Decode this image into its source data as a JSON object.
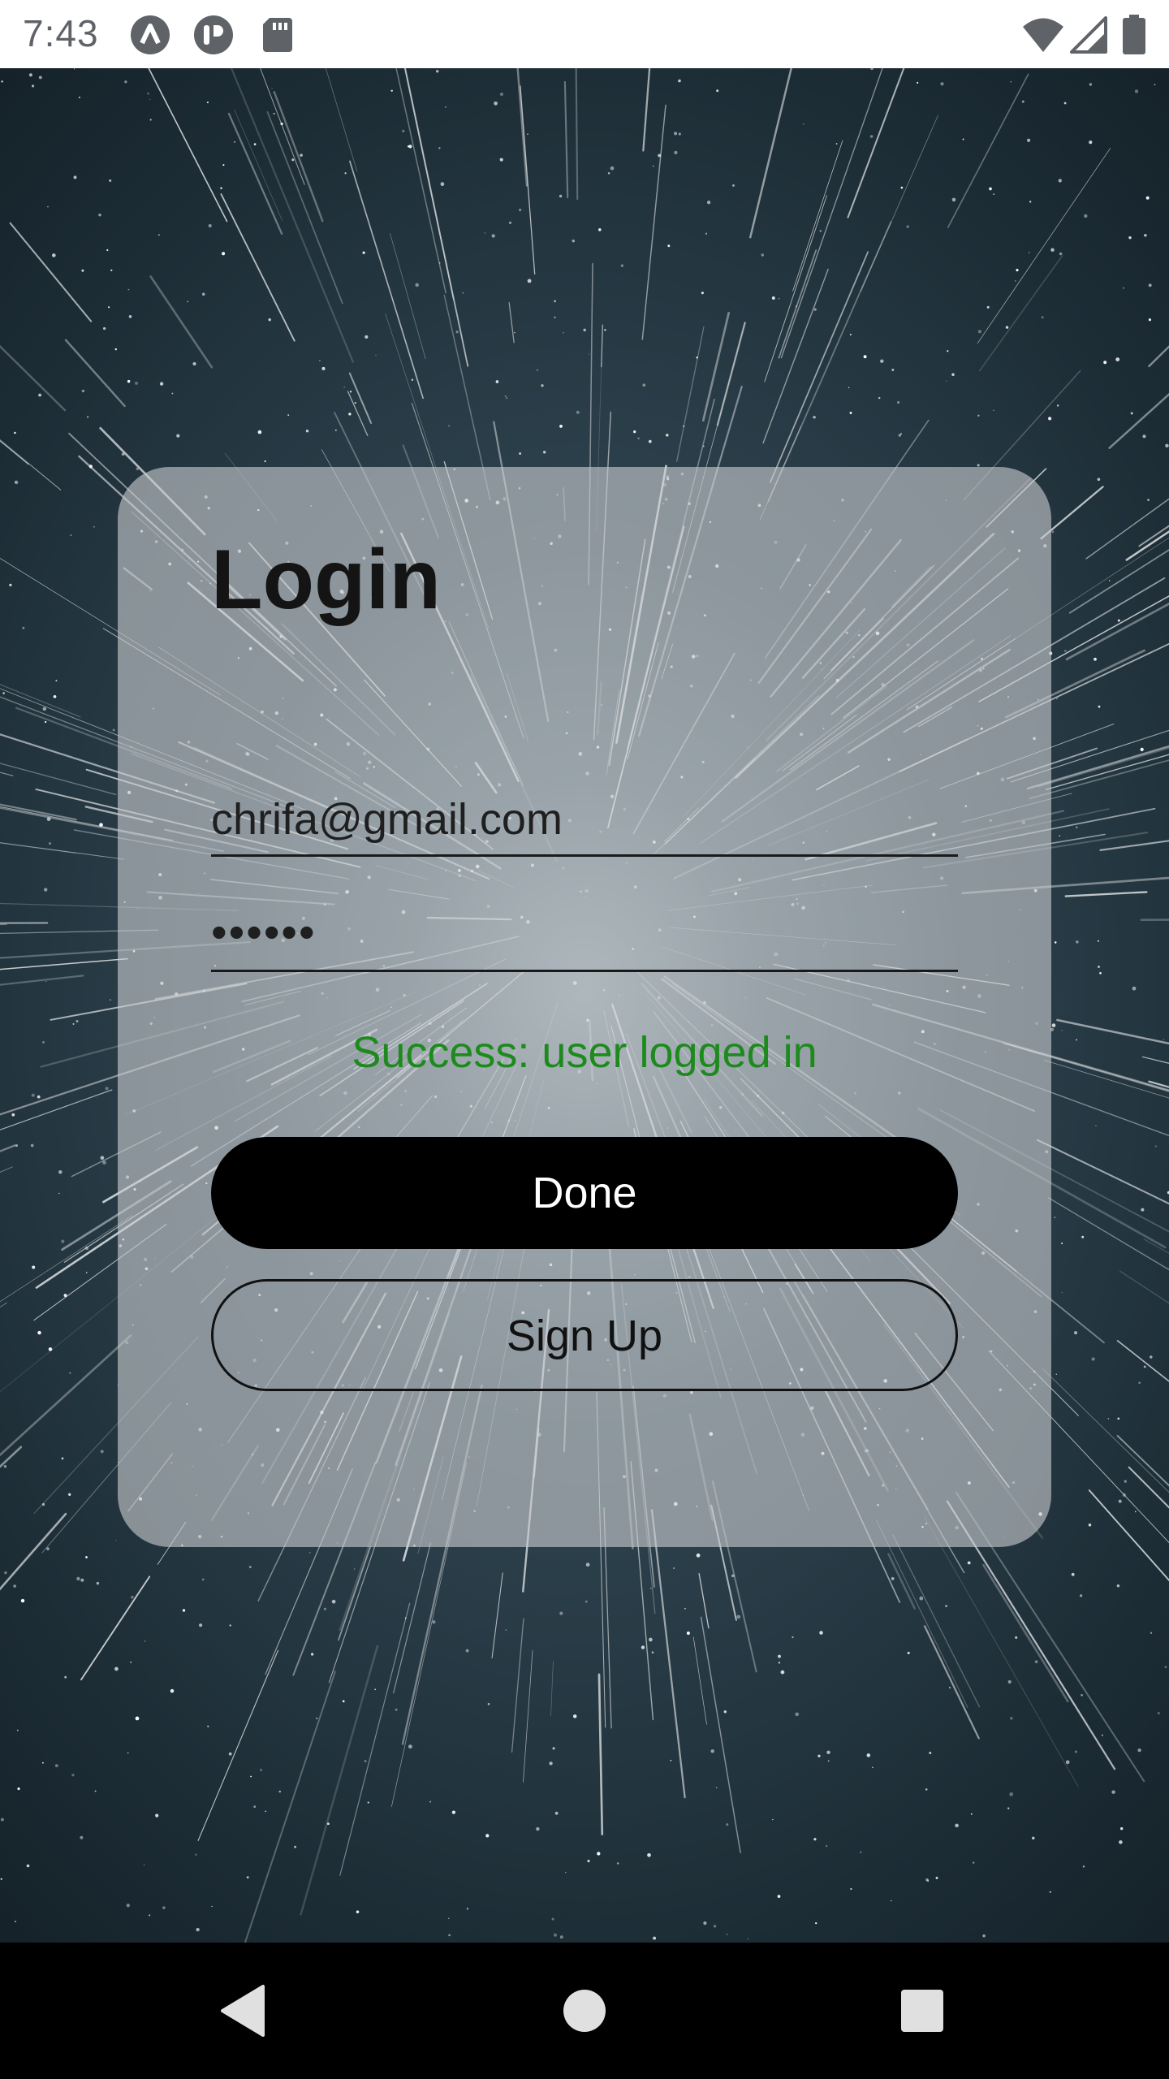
{
  "status_bar": {
    "time": "7:43",
    "left_icons": [
      "app-a-icon",
      "app-c-icon",
      "sd-card-icon"
    ],
    "right_icons": [
      "wifi-icon",
      "signal-icon",
      "battery-icon"
    ]
  },
  "login_card": {
    "title": "Login",
    "email_value": "chrifa@gmail.com",
    "password_value": "••••••",
    "status_message": "Success: user logged in",
    "status_color": "#1e8a1e",
    "done_button_label": "Done",
    "signup_button_label": "Sign Up"
  },
  "nav_bar": {
    "buttons": [
      "back-icon",
      "home-icon",
      "recents-icon"
    ]
  }
}
